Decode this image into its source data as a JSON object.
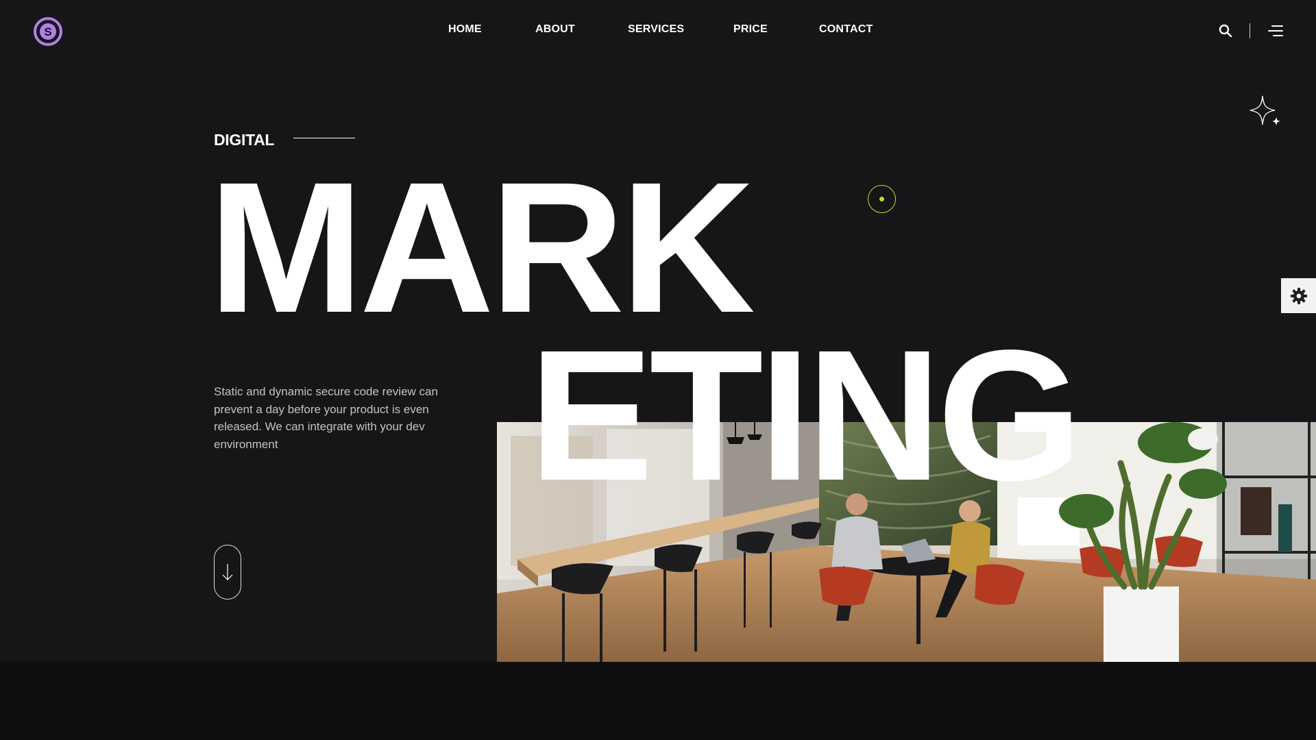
{
  "brand": {
    "logo_letter": "S",
    "logo_color": "#b57ee6"
  },
  "nav": {
    "items": [
      {
        "label": "HOME"
      },
      {
        "label": "ABOUT"
      },
      {
        "label": "SERVICES"
      },
      {
        "label": "PRICE"
      },
      {
        "label": "CONTACT"
      }
    ]
  },
  "header_tools": {
    "search_icon": "search-icon",
    "menu_icon": "menu-icon"
  },
  "hero": {
    "eyebrow": "DIGITAL",
    "headline_line1": "MARK",
    "headline_line2": "ETING",
    "description": "Static and dynamic secure code review can prevent a day before your product is even released. We can integrate with your dev environment",
    "accent_color": "#c5d92c",
    "scroll_icon": "arrow-down-icon",
    "image": "office-meeting-photo"
  },
  "settings": {
    "icon": "gear-icon"
  }
}
